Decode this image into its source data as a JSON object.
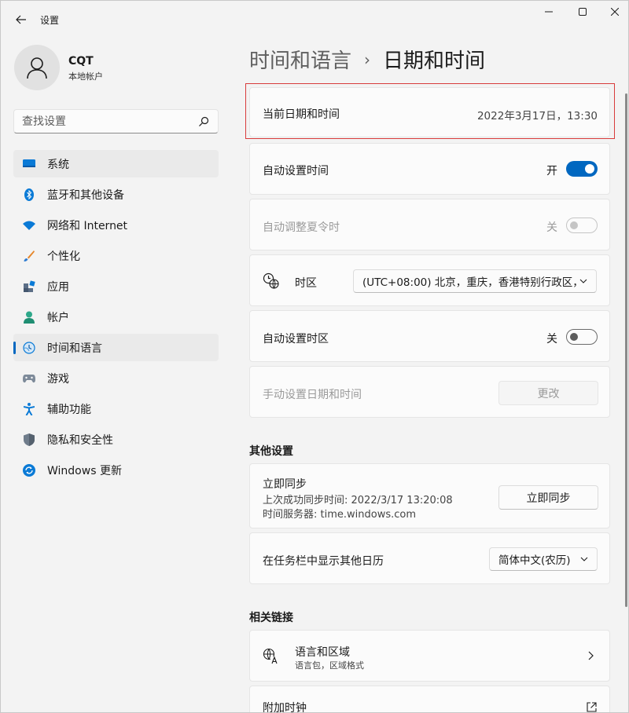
{
  "window": {
    "title": "设置",
    "controls": [
      "minimize",
      "maximize",
      "close"
    ]
  },
  "profile": {
    "name": "CQT",
    "account_type": "本地帐户"
  },
  "search": {
    "placeholder": "查找设置"
  },
  "sidebar": {
    "items": [
      {
        "label": "系统",
        "icon": "system-icon"
      },
      {
        "label": "蓝牙和其他设备",
        "icon": "bluetooth-icon"
      },
      {
        "label": "网络和 Internet",
        "icon": "wifi-icon"
      },
      {
        "label": "个性化",
        "icon": "brush-icon"
      },
      {
        "label": "应用",
        "icon": "apps-icon"
      },
      {
        "label": "帐户",
        "icon": "account-icon"
      },
      {
        "label": "时间和语言",
        "icon": "time-language-icon",
        "active": true
      },
      {
        "label": "游戏",
        "icon": "gamepad-icon"
      },
      {
        "label": "辅助功能",
        "icon": "accessibility-icon"
      },
      {
        "label": "隐私和安全性",
        "icon": "shield-icon"
      },
      {
        "label": "Windows 更新",
        "icon": "update-icon"
      }
    ]
  },
  "breadcrumb": {
    "parent": "时间和语言",
    "separator": "›",
    "current": "日期和时间"
  },
  "settings": {
    "current_datetime": {
      "label": "当前日期和时间",
      "value": "2022年3月17日，13:30"
    },
    "auto_time": {
      "label": "自动设置时间",
      "state": "开",
      "on": true
    },
    "auto_dst": {
      "label": "自动调整夏令时",
      "state": "关",
      "on": false,
      "disabled": true
    },
    "timezone": {
      "label": "时区",
      "value": "(UTC+08:00) 北京，重庆，香港特别行政区，"
    },
    "auto_timezone": {
      "label": "自动设置时区",
      "state": "关",
      "on": false
    },
    "manual_datetime": {
      "label": "手动设置日期和时间",
      "button": "更改",
      "disabled": true
    }
  },
  "other_settings": {
    "title": "其他设置",
    "sync": {
      "label": "立即同步",
      "last_sync": "上次成功同步时间: 2022/3/17 13:20:08",
      "server": "时间服务器: time.windows.com",
      "button": "立即同步"
    },
    "calendar": {
      "label": "在任务栏中显示其他日历",
      "value": "简体中文(农历)"
    }
  },
  "related_links": {
    "title": "相关链接",
    "language_region": {
      "label": "语言和区域",
      "sub": "语言包，区域格式"
    },
    "extra_clocks": {
      "label": "附加时钟"
    }
  },
  "colors": {
    "accent": "#0067c0",
    "highlight_border": "#d83b3b"
  }
}
